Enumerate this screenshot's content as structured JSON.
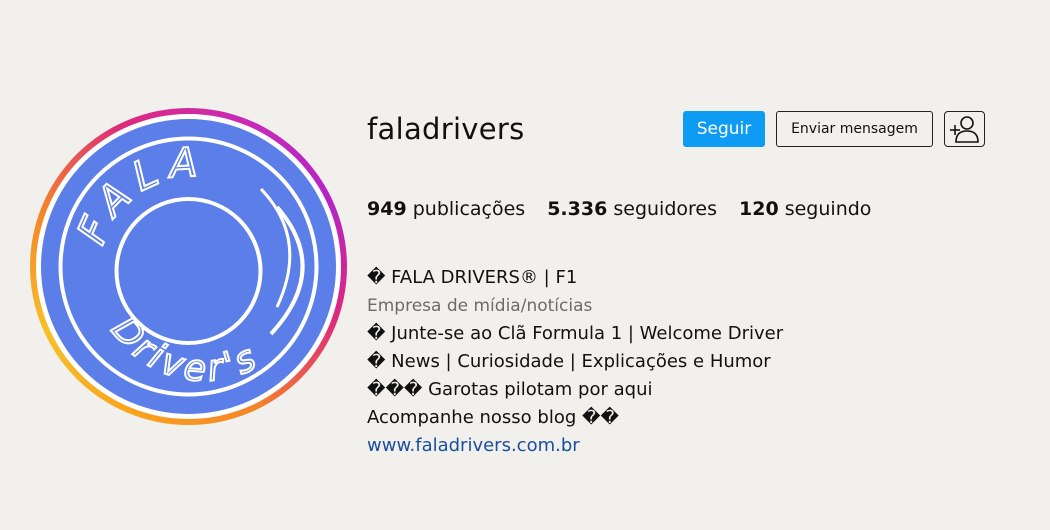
{
  "profile": {
    "username": "faladrivers",
    "avatar_text_top": "FALA",
    "avatar_text_bottom": "Driver's",
    "avatar_color": "#5b7ee8"
  },
  "actions": {
    "follow_label": "Seguir",
    "message_label": "Enviar mensagem",
    "add_user_icon": "add-user-icon",
    "follow_color": "#0d9bf4"
  },
  "stats": {
    "posts_count": "949",
    "posts_label": "publicações",
    "followers_count": "5.336",
    "followers_label": "seguidores",
    "following_count": "120",
    "following_label": "seguindo"
  },
  "bio": {
    "name": "� FALA DRIVERS® | F1",
    "category": "Empresa de mídia/notícias",
    "lines": [
      "� Junte-se ao Clã Formula 1 | Welcome Driver",
      "� News | Curiosidade | Explicações e Humor",
      "��� Garotas pilotam por aqui",
      "Acompanhe nosso blog ��"
    ],
    "website": "www.faladrivers.com.br",
    "link_color": "#1a4fa0"
  }
}
